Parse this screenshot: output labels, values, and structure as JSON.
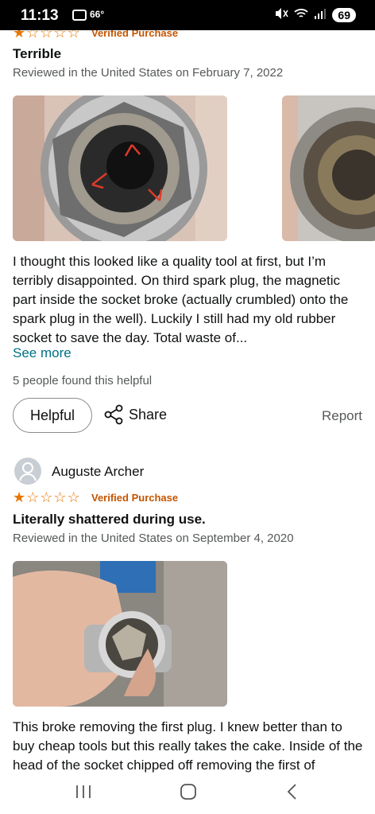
{
  "status_bar": {
    "time": "11:13",
    "temperature": "66°",
    "battery": "69"
  },
  "review1": {
    "verified": "Verified Purchase",
    "rating": 1,
    "title": "Terrible",
    "meta": "Reviewed in the United States on February 7, 2022",
    "body": "I thought this looked like a quality tool at first, but I’m terribly disappointed. On third spark plug, the magnetic part inside the socket broke (actually crumbled) onto the spark plug in the well). Luckily I still had my old rubber socket to save the day. Total waste of...",
    "see_more": "See more",
    "helpful_count": "5 people found this helpful",
    "helpful_label": "Helpful",
    "share_label": "Share",
    "report_label": "Report"
  },
  "review2": {
    "author": "Auguste Archer",
    "rating": 1,
    "verified": "Verified Purchase",
    "title": "Literally shattered during use.",
    "meta": "Reviewed in the United States on September 4, 2020",
    "body": "This broke removing the first plug. I knew better than to buy cheap tools but this really takes the cake. Inside of the head of the socket chipped off removing the first of"
  },
  "colors": {
    "star": "#e77600",
    "verified": "#c45500",
    "link": "#007185",
    "muted": "#565959"
  },
  "icons": [
    "photo-icon",
    "mute-icon",
    "wifi-icon",
    "signal-icon",
    "share-icon",
    "recents-icon",
    "home-icon",
    "back-icon"
  ]
}
